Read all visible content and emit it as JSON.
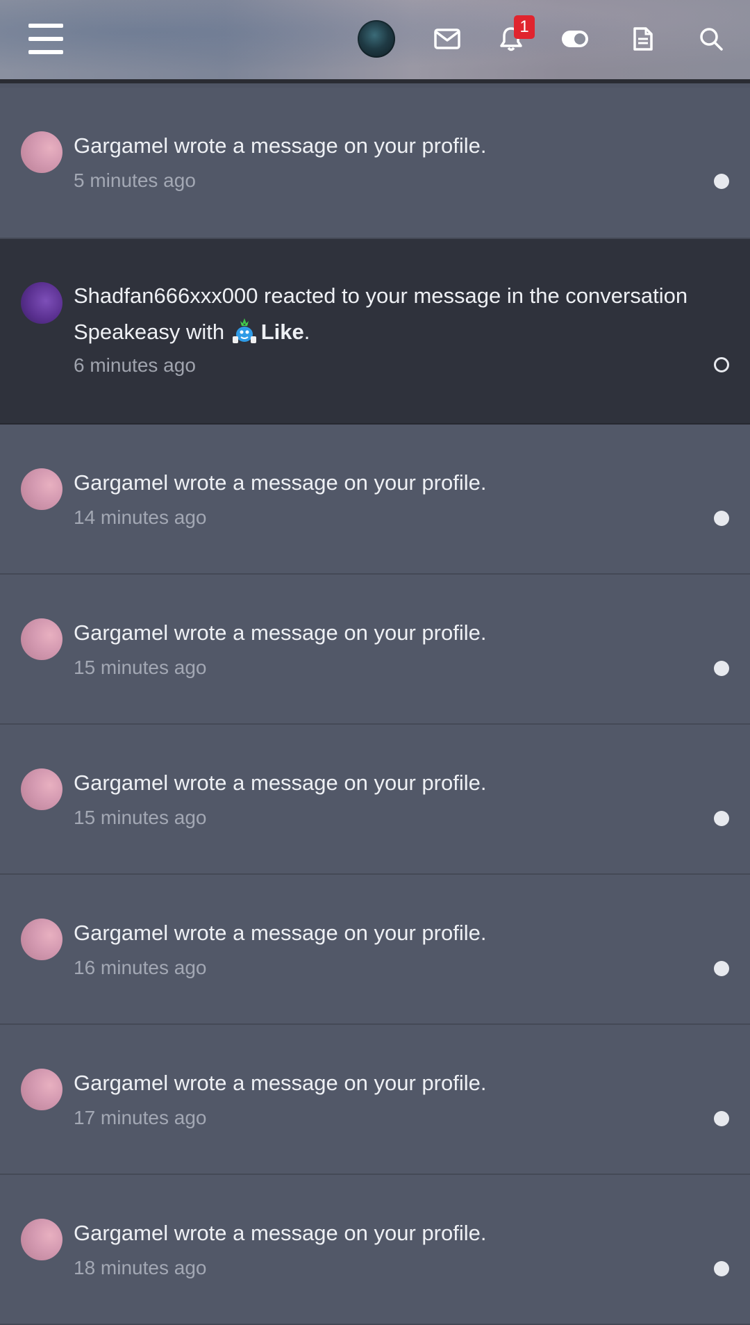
{
  "header": {
    "menu_icon": "hamburger-menu-icon",
    "avatar_icon": "user-avatar",
    "mail_icon": "envelope-icon",
    "bell_icon": "bell-icon",
    "notification_count": "1",
    "toggle_icon": "toggle-icon",
    "doc_icon": "document-icon",
    "search_icon": "search-icon"
  },
  "notifications": [
    {
      "user": "Gargamel",
      "text": "Gargamel wrote a message on your profile.",
      "time": "5 minutes ago",
      "read": false
    },
    {
      "user": "Shadfan666xxx000",
      "text_line1": "Shadfan666xxx000 reacted to your message in the conversation",
      "text_prefix": "Speakeasy with ",
      "reaction": "Like",
      "text_suffix": ".",
      "time": "6 minutes ago",
      "read": true
    },
    {
      "user": "Gargamel",
      "text": "Gargamel wrote a message on your profile.",
      "time": "14 minutes ago",
      "read": false
    },
    {
      "user": "Gargamel",
      "text": "Gargamel wrote a message on your profile.",
      "time": "15 minutes ago",
      "read": false
    },
    {
      "user": "Gargamel",
      "text": "Gargamel wrote a message on your profile.",
      "time": "15 minutes ago",
      "read": false
    },
    {
      "user": "Gargamel",
      "text": "Gargamel wrote a message on your profile.",
      "time": "16 minutes ago",
      "read": false
    },
    {
      "user": "Gargamel",
      "text": "Gargamel wrote a message on your profile.",
      "time": "17 minutes ago",
      "read": false
    },
    {
      "user": "Gargamel",
      "text": "Gargamel wrote a message on your profile.",
      "time": "18 minutes ago",
      "read": false
    }
  ]
}
